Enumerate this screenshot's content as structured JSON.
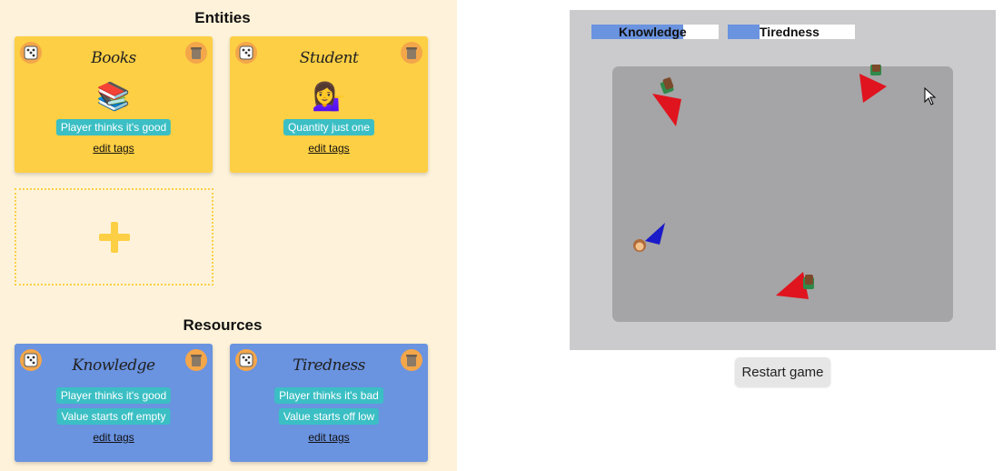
{
  "entities": {
    "title": "Entities",
    "cards": [
      {
        "name": "Books",
        "emoji": "📚",
        "tag": "Player thinks it's good",
        "link": "edit tags"
      },
      {
        "name": "Student",
        "emoji": "💁‍♀️",
        "tag": "Quantity just one",
        "link": "edit tags"
      }
    ]
  },
  "resources": {
    "title": "Resources",
    "cards": [
      {
        "name": "Knowledge",
        "tags": [
          "Player thinks it's good",
          "Value starts off empty"
        ],
        "link": "edit tags"
      },
      {
        "name": "Tiredness",
        "tags": [
          "Player thinks it's bad",
          "Value starts off low"
        ],
        "link": "edit tags"
      }
    ]
  },
  "game": {
    "meters": [
      {
        "label": "Knowledge",
        "value": 0.72
      },
      {
        "label": "Tiredness",
        "value": 0.25
      }
    ],
    "restart_label": "Restart game",
    "colors": {
      "enemy": "#e0141e",
      "player": "#1a1ac8",
      "field": "#a5a4a6",
      "meter_fill": "#6a93e0"
    }
  },
  "icons": {
    "dice": "dice-icon",
    "trash": "trash-icon",
    "plus": "plus-icon",
    "cursor": "mouse-cursor-icon"
  }
}
